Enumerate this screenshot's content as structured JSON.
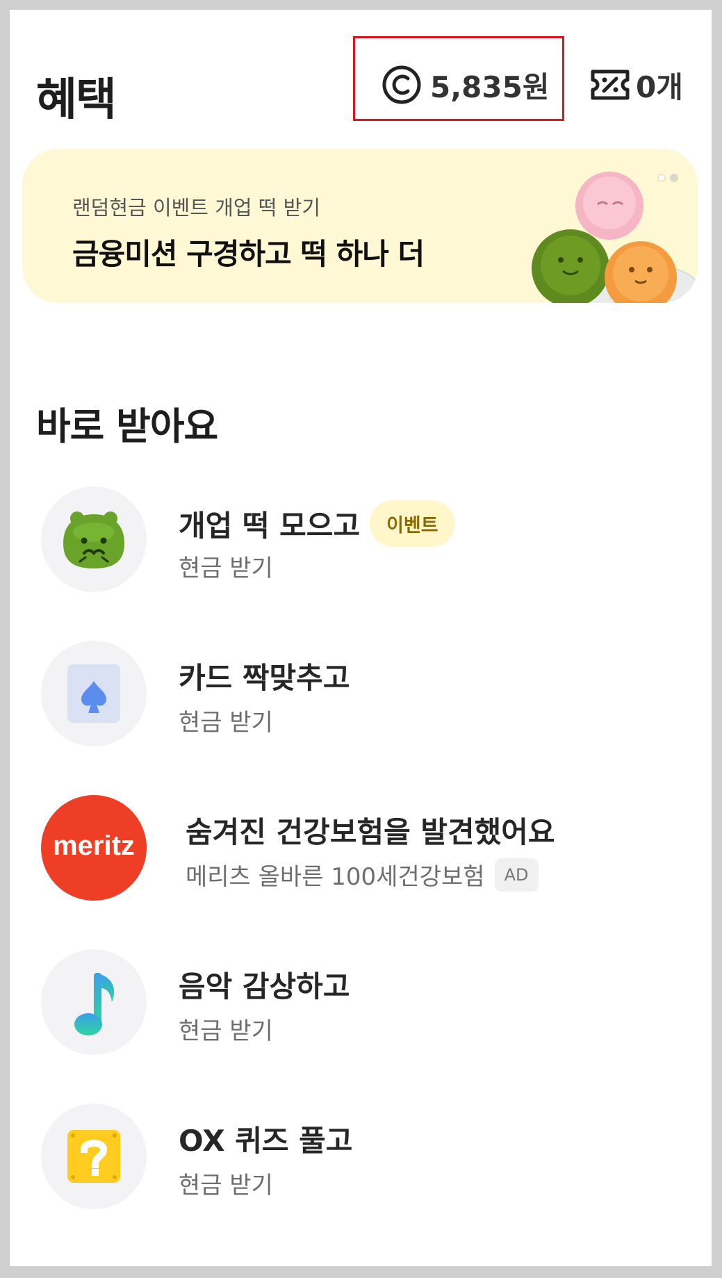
{
  "header": {
    "title": "혜택",
    "points": "5,835원",
    "coupons": "0개",
    "icons": {
      "points": "coin-icon",
      "coupons": "coupon-icon"
    }
  },
  "banner": {
    "subtitle": "랜덤현금 이벤트 개업 떡 받기",
    "title": "금융미션 구경하고 떡 하나 더",
    "background": "#fef8d5"
  },
  "section": {
    "title": "바로 받아요",
    "items": [
      {
        "title": "개업 떡 모으고",
        "badge": "이벤트",
        "subtitle": "현금 받기",
        "icon": "green-rice-cake-icon"
      },
      {
        "title": "카드 짝맞추고",
        "subtitle": "현금 받기",
        "icon": "spade-card-icon"
      },
      {
        "title": "숨겨진 건강보험을 발견했어요",
        "subtitle": "메리츠 올바른 100세건강보험",
        "badge": "AD",
        "logo_text": "meritz",
        "icon": "meritz-logo"
      },
      {
        "title": "음악 감상하고",
        "subtitle": "현금 받기",
        "icon": "music-note-icon"
      },
      {
        "title": "OX 퀴즈 풀고",
        "subtitle": "현금 받기",
        "icon": "question-block-icon"
      }
    ]
  },
  "colors": {
    "highlight_border": "#e3141f",
    "meritz": "#ef3e26",
    "event_badge_bg": "#fff6c9"
  }
}
